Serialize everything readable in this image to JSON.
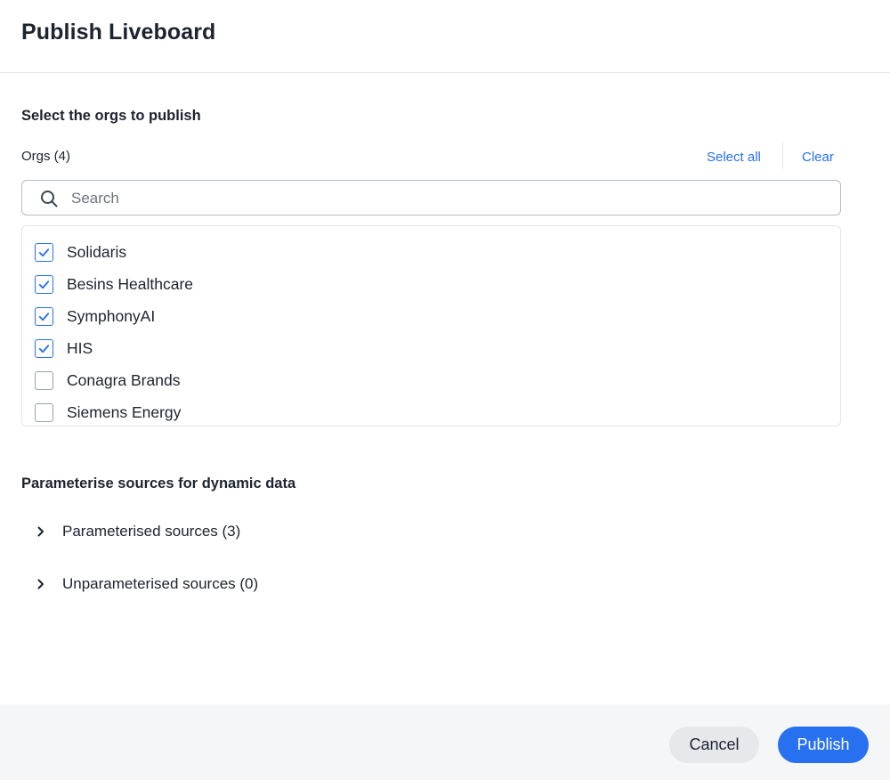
{
  "dialog": {
    "title": "Publish Liveboard"
  },
  "orgs_section": {
    "title": "Select the orgs to publish",
    "count_label": "Orgs (4)",
    "select_all_label": "Select all",
    "clear_label": "Clear",
    "search": {
      "placeholder": "Search",
      "value": ""
    },
    "items": [
      {
        "label": "Solidaris",
        "checked": true
      },
      {
        "label": "Besins Healthcare",
        "checked": true
      },
      {
        "label": "SymphonyAI",
        "checked": true
      },
      {
        "label": "HIS",
        "checked": true
      },
      {
        "label": "Conagra Brands",
        "checked": false
      },
      {
        "label": "Siemens Energy",
        "checked": false
      }
    ]
  },
  "sources_section": {
    "title": "Parameterise sources for dynamic data",
    "groups": [
      {
        "label": "Parameterised sources (3)"
      },
      {
        "label": "Unparameterised sources (0)"
      }
    ]
  },
  "footer": {
    "cancel_label": "Cancel",
    "publish_label": "Publish"
  },
  "colors": {
    "accent": "#2770ef",
    "text": "#1d232f",
    "footer_bg": "#f5f6f8",
    "cancel_bg": "#e6e8ec"
  },
  "icons": {
    "search": "search-icon",
    "checkbox_checked": "check-icon",
    "expand": "chevron-right-icon"
  }
}
